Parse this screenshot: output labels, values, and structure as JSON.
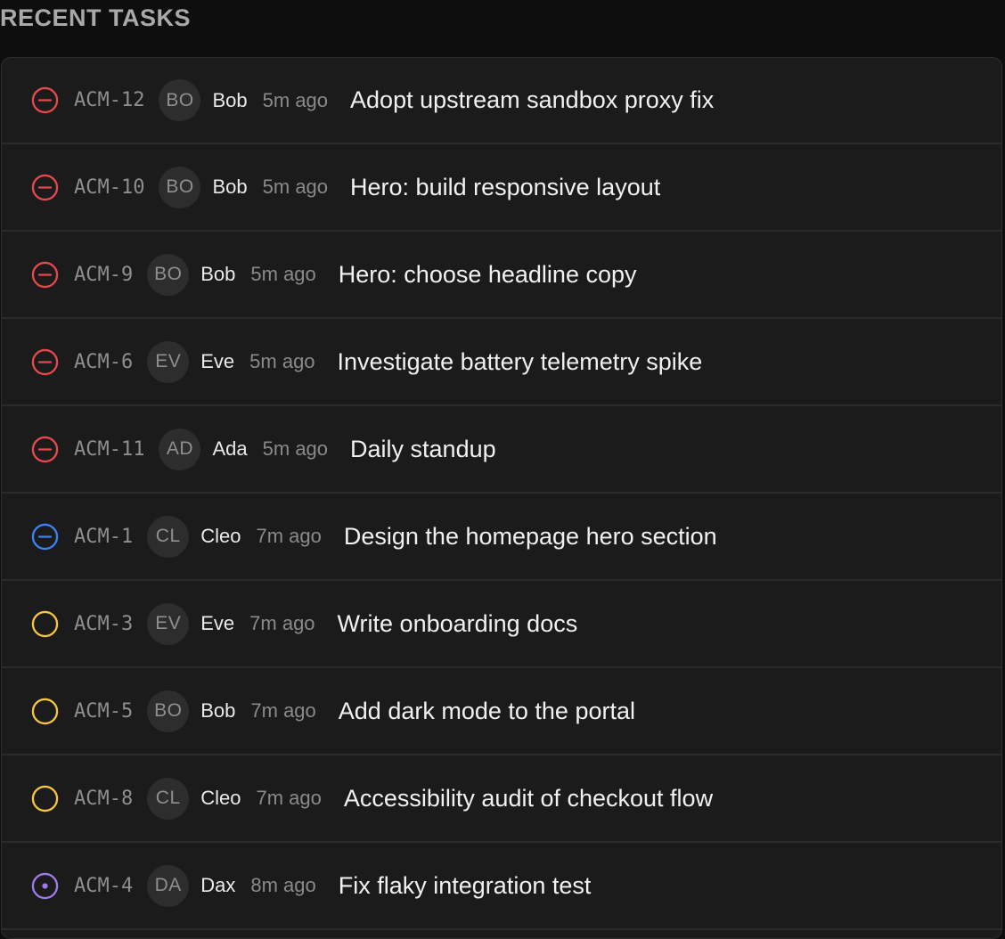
{
  "section": {
    "title": "RECENT TASKS"
  },
  "colors": {
    "blocked": "#e5484d",
    "in_progress": "#3b82f6",
    "todo": "#f5c541",
    "review": "#9f7aea"
  },
  "tasks": [
    {
      "id": "ACM-12",
      "initials": "BO",
      "assignee": "Bob",
      "time": "5m ago",
      "title": "Adopt upstream sandbox proxy fix",
      "status": "blocked",
      "icon": "minus-circle-icon"
    },
    {
      "id": "ACM-10",
      "initials": "BO",
      "assignee": "Bob",
      "time": "5m ago",
      "title": "Hero: build responsive layout",
      "status": "blocked",
      "icon": "minus-circle-icon"
    },
    {
      "id": "ACM-9",
      "initials": "BO",
      "assignee": "Bob",
      "time": "5m ago",
      "title": "Hero: choose headline copy",
      "status": "blocked",
      "icon": "minus-circle-icon"
    },
    {
      "id": "ACM-6",
      "initials": "EV",
      "assignee": "Eve",
      "time": "5m ago",
      "title": "Investigate battery telemetry spike",
      "status": "blocked",
      "icon": "minus-circle-icon"
    },
    {
      "id": "ACM-11",
      "initials": "AD",
      "assignee": "Ada",
      "time": "5m ago",
      "title": "Daily standup",
      "status": "blocked",
      "icon": "minus-circle-icon"
    },
    {
      "id": "ACM-1",
      "initials": "CL",
      "assignee": "Cleo",
      "time": "7m ago",
      "title": "Design the homepage hero section",
      "status": "in_progress",
      "icon": "minus-circle-icon"
    },
    {
      "id": "ACM-3",
      "initials": "EV",
      "assignee": "Eve",
      "time": "7m ago",
      "title": "Write onboarding docs",
      "status": "todo",
      "icon": "circle-icon"
    },
    {
      "id": "ACM-5",
      "initials": "BO",
      "assignee": "Bob",
      "time": "7m ago",
      "title": "Add dark mode to the portal",
      "status": "todo",
      "icon": "circle-icon"
    },
    {
      "id": "ACM-8",
      "initials": "CL",
      "assignee": "Cleo",
      "time": "7m ago",
      "title": "Accessibility audit of checkout flow",
      "status": "todo",
      "icon": "circle-icon"
    },
    {
      "id": "ACM-4",
      "initials": "DA",
      "assignee": "Dax",
      "time": "8m ago",
      "title": "Fix flaky integration test",
      "status": "review",
      "icon": "dot-circle-icon"
    }
  ]
}
